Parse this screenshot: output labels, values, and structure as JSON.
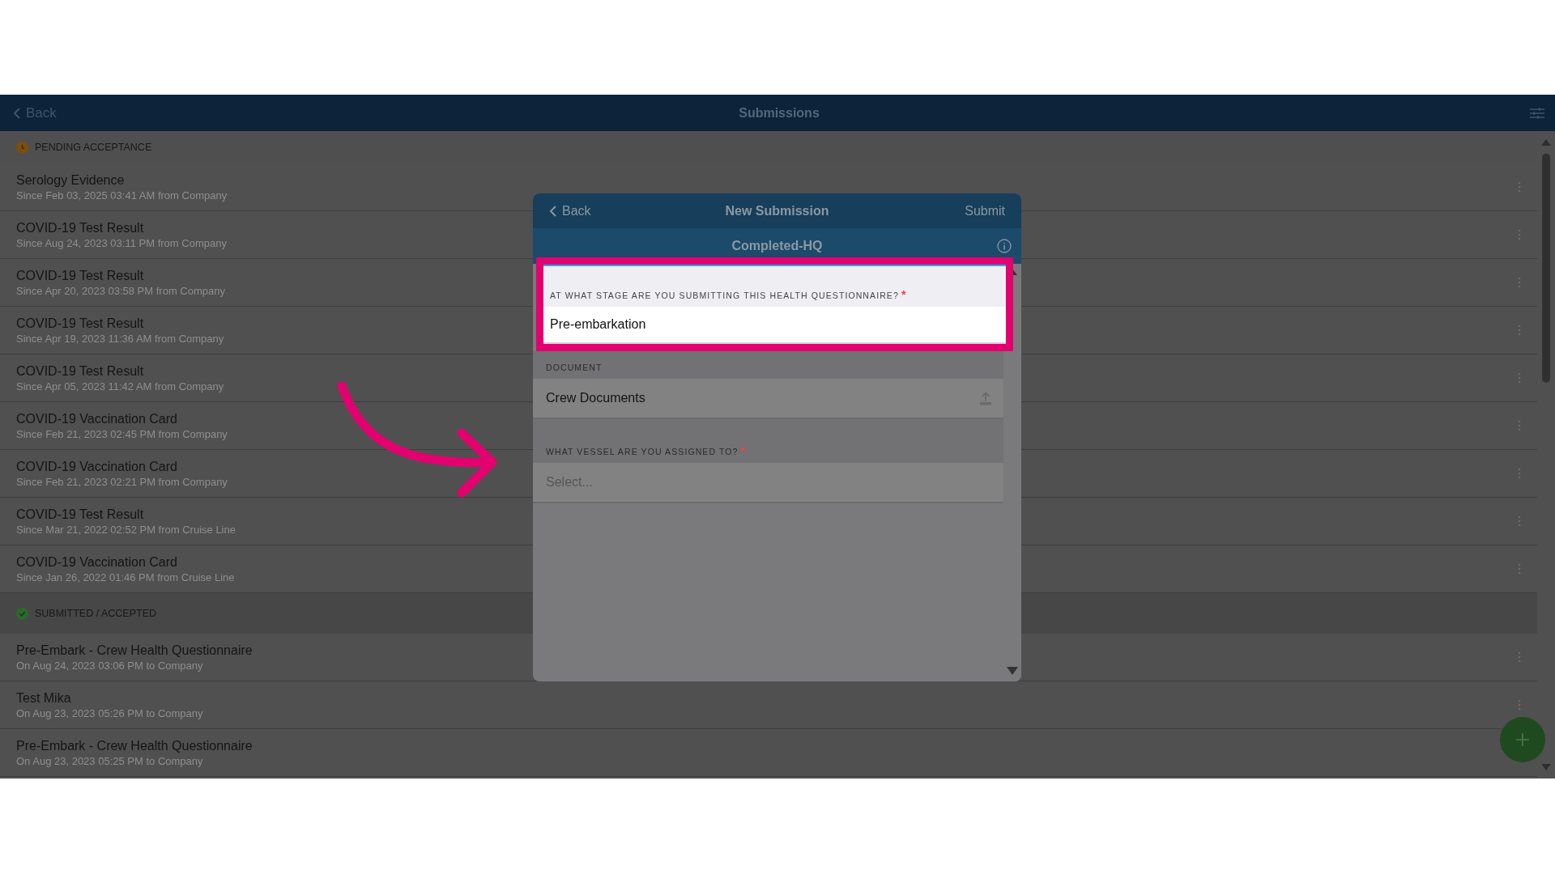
{
  "header": {
    "back": "Back",
    "title": "Submissions"
  },
  "sections": [
    {
      "kind": "pending",
      "title": "PENDING ACCEPTANCE",
      "items": [
        {
          "title": "Serology Evidence",
          "subtitle": "Since Feb 03, 2025 03:41 AM from Company"
        },
        {
          "title": "COVID-19 Test Result",
          "subtitle": "Since Aug 24, 2023 03:11 PM from Company"
        },
        {
          "title": "COVID-19 Test Result",
          "subtitle": "Since Apr 20, 2023 03:58 PM from Company"
        },
        {
          "title": "COVID-19 Test Result",
          "subtitle": "Since Apr 19, 2023 11:36 AM from Company"
        },
        {
          "title": "COVID-19 Test Result",
          "subtitle": "Since Apr 05, 2023 11:42 AM from Company"
        },
        {
          "title": "COVID-19 Vaccination Card",
          "subtitle": "Since Feb 21, 2023 02:45 PM from Company"
        },
        {
          "title": "COVID-19 Vaccination Card",
          "subtitle": "Since Feb 21, 2023 02:21 PM from Company"
        },
        {
          "title": "COVID-19 Test Result",
          "subtitle": "Since Mar 21, 2022 02:52 PM from Cruise Line"
        },
        {
          "title": "COVID-19 Vaccination Card",
          "subtitle": "Since Jan 26, 2022 01:46 PM from Cruise Line"
        }
      ]
    },
    {
      "kind": "accepted",
      "title": "SUBMITTED / ACCEPTED",
      "items": [
        {
          "title": "Pre-Embark - Crew Health Questionnaire",
          "subtitle": "On Aug 24, 2023 03:06 PM to Company"
        },
        {
          "title": "Test Mika",
          "subtitle": "On Aug 23, 2023 05:26 PM to Company"
        },
        {
          "title": "Pre-Embark - Crew Health Questionnaire",
          "subtitle": "On Aug 23, 2023 05:25 PM to Company"
        }
      ]
    }
  ],
  "modal": {
    "back": "Back",
    "title": "New Submission",
    "submit": "Submit",
    "subtitle": "Completed-HQ",
    "fields": [
      {
        "kind": "text",
        "label": "AT WHAT STAGE ARE YOU SUBMITTING THIS HEALTH QUESTIONNAIRE?",
        "required_mark": "*",
        "value": "Pre-embarkation",
        "highlighted": true
      },
      {
        "kind": "document",
        "label": "DOCUMENT",
        "value": "Crew Documents",
        "highlighted": false
      },
      {
        "kind": "select",
        "label": "WHAT VESSEL ARE YOU ASSIGNED TO?",
        "required_mark": "*",
        "placeholder": "Select...",
        "highlighted": false
      }
    ]
  }
}
